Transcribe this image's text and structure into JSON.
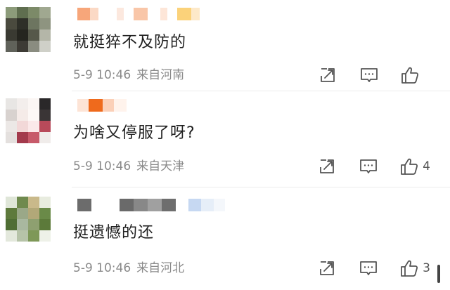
{
  "comments": [
    {
      "text": "就挺猝不及防的",
      "time": "5-9 10:46",
      "location": "来自河南",
      "likes": ""
    },
    {
      "text": "为啥又停服了呀?",
      "time": "5-9 10:46",
      "location": "来自天津",
      "likes": "4"
    },
    {
      "text": "挺遗憾的还",
      "time": "5-9 10:46",
      "location": "来自河北",
      "likes": "3"
    }
  ],
  "icons": {
    "share": "share-icon",
    "reply": "comment-icon",
    "like": "thumbs-up-icon"
  },
  "colors": {
    "text": "#1e1e1e",
    "meta": "#8a8a8a",
    "icon": "#555555"
  }
}
